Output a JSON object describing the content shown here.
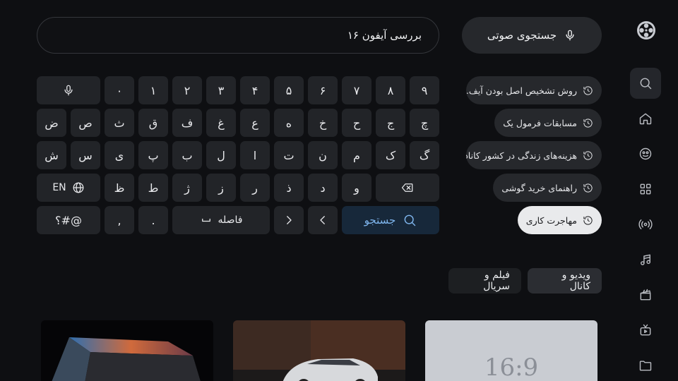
{
  "sidebar": {
    "items": [
      {
        "icon": "search-icon",
        "active": true
      },
      {
        "icon": "home-icon",
        "active": false
      },
      {
        "icon": "gamepad-icon",
        "active": false
      },
      {
        "icon": "grid-icon",
        "active": false
      },
      {
        "icon": "broadcast-icon",
        "active": false
      },
      {
        "icon": "music-icon",
        "active": false
      },
      {
        "icon": "film-icon",
        "active": false
      },
      {
        "icon": "tv-icon",
        "active": false
      },
      {
        "icon": "folder-icon",
        "active": false
      }
    ]
  },
  "header": {
    "voice_search_label": "جستجوی صوتی",
    "search_value": "بررسی آیفون ۱۶"
  },
  "keyboard": {
    "row1": [
      "۹",
      "۸",
      "۷",
      "۶",
      "۵",
      "۴",
      "۳",
      "۲",
      "۱",
      "۰"
    ],
    "row2": [
      "چ",
      "ج",
      "ح",
      "خ",
      "ه",
      "ع",
      "غ",
      "ف",
      "ق",
      "ث",
      "ص",
      "ض"
    ],
    "row3": [
      "گ",
      "ک",
      "م",
      "ن",
      "ت",
      "ا",
      "ل",
      "ب",
      "پ",
      "ی",
      "س",
      "ش"
    ],
    "row4": [
      "و",
      "د",
      "ذ",
      "ر",
      "ز",
      "ژ",
      "ط",
      "ظ"
    ],
    "lang_label": "EN",
    "space_label": "فاصله",
    "search_label": "جستجو",
    "period": ".",
    "comma": ",",
    "symbols_label": "؟#@"
  },
  "history": [
    {
      "text": "روش تشخیص اصل بودن آیف..."
    },
    {
      "text": "مسابقات فرمول یک"
    },
    {
      "text": "هزینه‌های زندگی در کشور کاناد..."
    },
    {
      "text": "راهنمای خرید گوشی"
    },
    {
      "text": "مهاجرت کاری",
      "active": true
    }
  ],
  "filters": [
    {
      "label": "ویدیو و کانال",
      "active": true
    },
    {
      "label": "فیلم و سریال",
      "active": false
    }
  ],
  "results": {
    "placeholder_text": "16:9"
  },
  "colors": {
    "background": "#0e0f12",
    "key": "#222428",
    "search_key_bg": "#17283a",
    "search_key_text": "#7fb6ee",
    "chip_active": "#e9eaec"
  }
}
